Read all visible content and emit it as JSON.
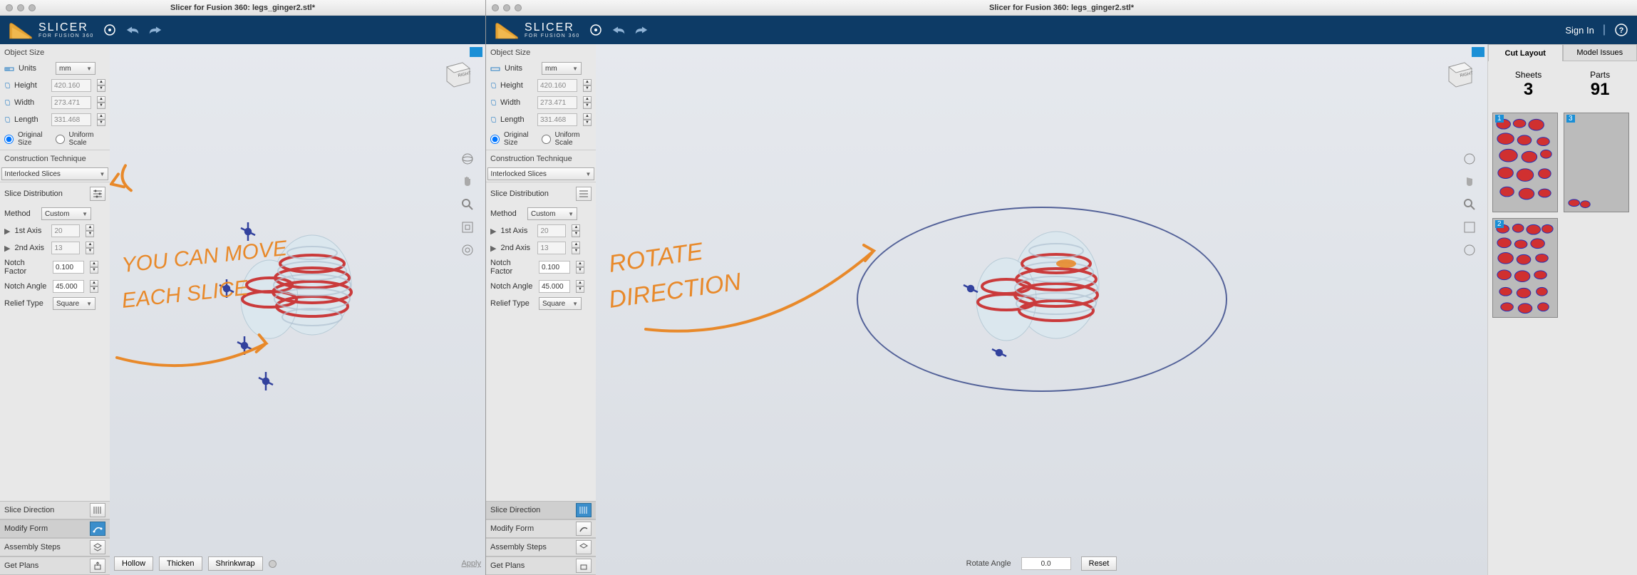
{
  "left": {
    "titlebar": "Slicer for Fusion 360: legs_ginger2.stl*",
    "brand": {
      "name": "SLICER",
      "sub": "FOR FUSION 360"
    },
    "object_size_label": "Object Size",
    "units_label": "Units",
    "units_value": "mm",
    "height_label": "Height",
    "height_value": "420.160",
    "width_label": "Width",
    "width_value": "273.471",
    "length_label": "Length",
    "length_value": "331.468",
    "scale_mode_original": "Original Size",
    "scale_mode_uniform": "Uniform Scale",
    "construction_technique_label": "Construction Technique",
    "construction_technique_value": "Interlocked Slices",
    "slice_distribution_label": "Slice Distribution",
    "method_label": "Method",
    "method_value": "Custom",
    "axis1_label": "1st Axis",
    "axis1_value": "20",
    "axis2_label": "2nd Axis",
    "axis2_value": "13",
    "notch_factor_label": "Notch Factor",
    "notch_factor_value": "0.100",
    "notch_angle_label": "Notch Angle",
    "notch_angle_value": "45.000",
    "relief_type_label": "Relief Type",
    "relief_type_value": "Square",
    "slice_direction_label": "Slice Direction",
    "modify_form_label": "Modify Form",
    "assembly_steps_label": "Assembly Steps",
    "get_plans_label": "Get Plans",
    "bottom": {
      "hollow": "Hollow",
      "thicken": "Thicken",
      "shrinkwrap": "Shrinkwrap",
      "apply": "Apply"
    },
    "cube_face": "RIGHT",
    "annotation1": "YOU CAN MOVE",
    "annotation2": "EACH SLICE"
  },
  "right": {
    "titlebar": "Slicer for Fusion 360: legs_ginger2.stl*",
    "brand": {
      "name": "SLICER",
      "sub": "FOR FUSION 360"
    },
    "signin": "Sign In",
    "object_size_label": "Object Size",
    "units_label": "Units",
    "units_value": "mm",
    "height_label": "Height",
    "height_value": "420.160",
    "width_label": "Width",
    "width_value": "273.471",
    "length_label": "Length",
    "length_value": "331.468",
    "scale_mode_original": "Original Size",
    "scale_mode_uniform": "Uniform Scale",
    "construction_technique_label": "Construction Technique",
    "construction_technique_value": "Interlocked Slices",
    "slice_distribution_label": "Slice Distribution",
    "method_label": "Method",
    "method_value": "Custom",
    "axis1_label": "1st Axis",
    "axis1_value": "20",
    "axis2_label": "2nd Axis",
    "axis2_value": "13",
    "notch_factor_label": "Notch Factor",
    "notch_factor_value": "0.100",
    "notch_angle_label": "Notch Angle",
    "notch_angle_value": "45.000",
    "relief_type_label": "Relief Type",
    "relief_type_value": "Square",
    "slice_direction_label": "Slice Direction",
    "modify_form_label": "Modify Form",
    "assembly_steps_label": "Assembly Steps",
    "get_plans_label": "Get Plans",
    "cube_face": "RIGHT",
    "bottom": {
      "rotate_angle_label": "Rotate Angle",
      "rotate_angle_value": "0.0",
      "reset": "Reset"
    },
    "cutpanel": {
      "tab_cut": "Cut Layout",
      "tab_issues": "Model Issues",
      "sheets_label": "Sheets",
      "sheets_value": "3",
      "parts_label": "Parts",
      "parts_value": "91",
      "sheet_nums": [
        "1",
        "3",
        "2"
      ]
    },
    "annotation1": "ROTATE",
    "annotation2": "DIRECTION"
  }
}
